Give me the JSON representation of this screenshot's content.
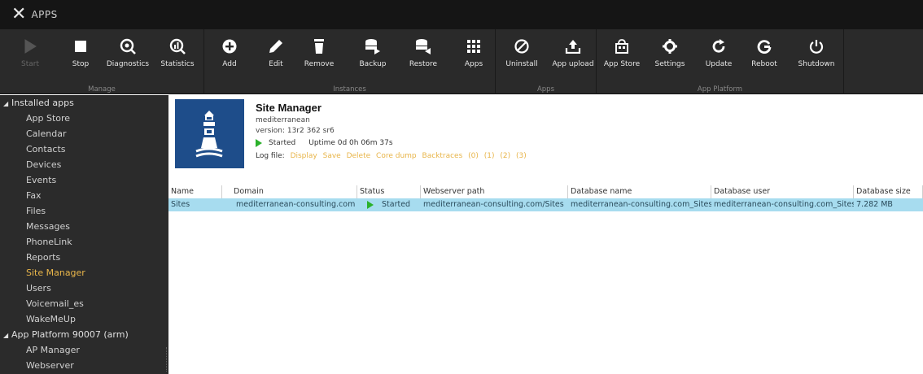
{
  "title": "APPS",
  "toolbar": {
    "groups": [
      {
        "label": "Manage"
      },
      {
        "label": "Instances"
      },
      {
        "label": "Apps"
      },
      {
        "label": "App Platform"
      }
    ],
    "buttons": [
      {
        "label": "Start",
        "icon": "play-icon",
        "enabled": false
      },
      {
        "label": "Stop",
        "icon": "stop-icon",
        "enabled": true
      },
      {
        "label": "Diagnostics",
        "icon": "diagnostics-icon",
        "enabled": true
      },
      {
        "label": "Statistics",
        "icon": "statistics-icon",
        "enabled": true
      },
      {
        "label": "Add",
        "icon": "add-icon",
        "enabled": true
      },
      {
        "label": "Edit",
        "icon": "pencil-icon",
        "enabled": true
      },
      {
        "label": "Remove",
        "icon": "trash-icon",
        "enabled": true
      },
      {
        "label": "Backup",
        "icon": "backup-icon",
        "enabled": true
      },
      {
        "label": "Restore",
        "icon": "restore-icon",
        "enabled": true
      },
      {
        "label": "Apps",
        "icon": "grid-icon",
        "enabled": true
      },
      {
        "label": "Uninstall",
        "icon": "uninstall-icon",
        "enabled": true
      },
      {
        "label": "App upload",
        "icon": "upload-icon",
        "enabled": true
      },
      {
        "label": "App Store",
        "icon": "store-icon",
        "enabled": true
      },
      {
        "label": "Settings",
        "icon": "gear-icon",
        "enabled": true
      },
      {
        "label": "Update",
        "icon": "update-icon",
        "enabled": true
      },
      {
        "label": "Reboot",
        "icon": "reboot-icon",
        "enabled": true
      },
      {
        "label": "Shutdown",
        "icon": "power-icon",
        "enabled": true
      }
    ]
  },
  "sidebar": {
    "groups": [
      {
        "label": "Installed apps",
        "items": [
          "App Store",
          "Calendar",
          "Contacts",
          "Devices",
          "Events",
          "Fax",
          "Files",
          "Messages",
          "PhoneLink",
          "Reports",
          "Site Manager",
          "Users",
          "Voicemail_es",
          "WakeMeUp"
        ]
      },
      {
        "label": "App Platform 90007 (arm)",
        "items": [
          "AP Manager",
          "Webserver"
        ]
      }
    ],
    "selected": "Site Manager"
  },
  "app": {
    "name": "Site Manager",
    "vendor": "mediterranean",
    "version": "version: 13r2 362 sr6",
    "status": "Started",
    "uptime": "Uptime 0d 0h 06m 37s",
    "log_label": "Log file:",
    "log_links": [
      "Display",
      "Save",
      "Delete",
      "Core dump",
      "Backtraces",
      "(0)",
      "(1)",
      "(2)",
      "(3)"
    ]
  },
  "table": {
    "columns": [
      "Name",
      "Domain",
      "Status",
      "Webserver path",
      "Database name",
      "Database user",
      "Database size"
    ],
    "sort_indicator": "^",
    "rows": [
      [
        "Sites",
        "mediterranean-consulting.com",
        "Started",
        "mediterranean-consulting.com/Sites",
        "mediterranean-consulting.com_Sites",
        "mediterranean-consulting.com_Sites",
        "7.282 MB"
      ]
    ]
  },
  "colors": {
    "titlebar": "#151515",
    "toolbar": "#2a2a2a",
    "sidebar": "#2b2b2b",
    "accent": "#e8b54a",
    "row_selected": "#a7dcef",
    "status_green": "#2bb12b",
    "app_icon_bg": "#1e4d8a"
  }
}
